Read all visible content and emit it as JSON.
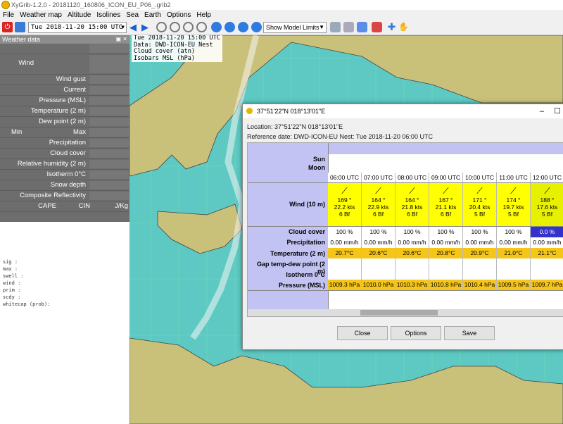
{
  "window": {
    "title": "XyGrib-1.2.0 - 20181120_160806_ICON_EU_P06_.grib2"
  },
  "menu": [
    "File",
    "Weather map",
    "Altitude",
    "Isolines",
    "Sea",
    "Earth",
    "Options",
    "Help"
  ],
  "toolbar": {
    "date_value": "Tue 2018-11-20 15:00 UTC",
    "model_limits": "Show Model Limits"
  },
  "weather_panel": {
    "title": "Weather data",
    "rows": [
      "Wind",
      "Wind gust",
      "Current",
      "Pressure (MSL)",
      "Temperature (2 m)",
      "Dew point (2 m)",
      "Min",
      "Max",
      "Precipitation",
      "Cloud cover",
      "Relative humidity (2 m)",
      "Isotherm 0°C",
      "Snow depth",
      "Composite Reflectivity",
      "CAPE",
      "CIN",
      "J/Kg"
    ]
  },
  "console": [
    "sig   :",
    "max   :",
    "swell :",
    "wind  :",
    "prim  :",
    "scdy  :",
    "whitecap (prob):"
  ],
  "map_info": [
    "Tue 2018-11-20 15:00 UTC",
    "Data: DWD-ICON-EU Nest",
    "Cloud cover (atn)",
    "Isobars MSL (hPa)"
  ],
  "dialog": {
    "title": "37°51'22\"N 018°13'01\"E",
    "location": "Location:  37°51'22\"N  018°13'01\"E",
    "reference": "Reference date: DWD-ICON-EU Nest: Tue 2018-11-20 06:00 UTC",
    "row_labels": {
      "sun": "Sun",
      "moon": "Moon",
      "wind": "Wind (10 m)",
      "cloud": "Cloud cover",
      "precip": "Precipitation",
      "temp": "Temperature (2 m)",
      "gap": "Gap temp-dew point (2 m)",
      "iso": "Isotherm 0°C",
      "pressure": "Pressure (MSL)"
    },
    "columns": [
      {
        "time": "06:00 UTC",
        "dir": "169 °",
        "speed": "22.2  kts",
        "bf": "6 Bf",
        "cloud": "100 %",
        "precip": "0.00 mm/h",
        "temp": "20.7°C",
        "pressure": "1009.3 hPa"
      },
      {
        "time": "07:00 UTC",
        "dir": "164 °",
        "speed": "22.9  kts",
        "bf": "6 Bf",
        "cloud": "100 %",
        "precip": "0.00 mm/h",
        "temp": "20.6°C",
        "pressure": "1010.0 hPa"
      },
      {
        "time": "08:00 UTC",
        "dir": "164 °",
        "speed": "21.8  kts",
        "bf": "6 Bf",
        "cloud": "100 %",
        "precip": "0.00 mm/h",
        "temp": "20.6°C",
        "pressure": "1010.3 hPa"
      },
      {
        "time": "09:00 UTC",
        "dir": "167 °",
        "speed": "21.1  kts",
        "bf": "6 Bf",
        "cloud": "100 %",
        "precip": "0.00 mm/h",
        "temp": "20.8°C",
        "pressure": "1010.8 hPa"
      },
      {
        "time": "10:00 UTC",
        "dir": "171 °",
        "speed": "20.4  kts",
        "bf": "5 Bf",
        "cloud": "100 %",
        "precip": "0.00 mm/h",
        "temp": "20.9°C",
        "pressure": "1010.4 hPa"
      },
      {
        "time": "11:00 UTC",
        "dir": "174 °",
        "speed": "19.7  kts",
        "bf": "5 Bf",
        "cloud": "100 %",
        "precip": "0.00 mm/h",
        "temp": "21.0°C",
        "pressure": "1009.5 hPa"
      },
      {
        "time": "12:00 UTC",
        "dir": "188 °",
        "speed": "17.6  kts",
        "bf": "5 Bf",
        "cloud": "0.0 %",
        "precip": "0.00 mm/h",
        "temp": "21.1°C",
        "pressure": "1009.7 hPa"
      }
    ],
    "buttons": {
      "close": "Close",
      "options": "Options",
      "save": "Save"
    }
  },
  "colors": {
    "wind_yellow": "#ffff00",
    "wind_lime": "#e6f000",
    "cloud_blue": "#3333cc",
    "temp_orange": "#f5c518",
    "header_lavender": "#c3c3f3",
    "sea": "#5ec9c3",
    "land": "#c9c07a"
  }
}
